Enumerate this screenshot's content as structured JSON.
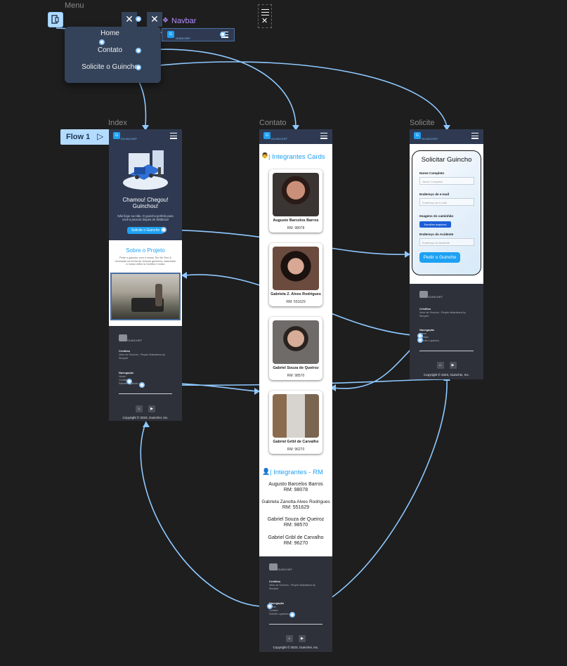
{
  "canvas": {
    "frame_labels": {
      "menu": "Menu",
      "navbar": "Navbar",
      "index": "Index",
      "contato": "Contato",
      "solicite": "Solicite"
    },
    "flow_label": "Flow 1",
    "colors": {
      "background": "#1e1e1e",
      "connector": "#8ec8ff",
      "navbar": "#2f3a52",
      "accent": "#1ea1f2",
      "footer": "#2e3139"
    }
  },
  "navbar": {
    "logo_text": "GUINCHEF",
    "menu_icon": "hamburger-icon"
  },
  "menu": {
    "items": [
      "Home",
      "Contato",
      "Solicite o Guincho"
    ]
  },
  "index": {
    "hero_title": "Chamou!  Chegou! Guinchou!",
    "hero_text": "Não fique na mão. O guincho perfeito para você a poucos cliques de distância!",
    "cta": "Solicite o Guincho",
    "about_title": "Sobre o Projeto",
    "about_text": "Pede o guincho com o nosso Tec Wc Tec! A revolução na forma de chamar guinchos, associado a nossa valha Ia Guinba e nosso"
  },
  "footer": {
    "logo_text": "GUINCHEF",
    "credits_title": "Créditos",
    "credits_text": "Vetor de Guincho - People illustrations by Storyset",
    "nav_title": "Navegação",
    "nav_items": [
      "Home",
      "Contato",
      "Solicite o guincho"
    ],
    "copyright": "Copyright © 2023, Guinchei, Inc."
  },
  "contato": {
    "cards_title": "| Integrantes Cards",
    "cards": [
      {
        "name": "Augusto Barcelos Barros",
        "rm": "RM: 98078"
      },
      {
        "name": "Gabriela Z. Alves Rodrigues",
        "rm": "RM: 551629"
      },
      {
        "name": "Gabriel Souza de Queiroz",
        "rm": "RM: 98570"
      },
      {
        "name": "Gabriel Gribl de Carvalho",
        "rm": "RM: 96270"
      }
    ],
    "rm_title": "| Integrantes - RM",
    "rm_list": [
      {
        "name": "Augusto Barcelos Barros",
        "rm": "RM: 98078"
      },
      {
        "name": "Gabriela Zanotta Alves Rodrigues",
        "rm": "RM: 551629"
      },
      {
        "name": "Gabriel Souza de Queiroz",
        "rm": "RM: 98570"
      },
      {
        "name": "Gabriel Gribl de Carvalho",
        "rm": "RM: 96270"
      }
    ]
  },
  "solicite": {
    "form_title": "Solicitar Guincho",
    "full_name_label": "Nome Completo",
    "full_name_placeholder": "Nome Completo",
    "email_label": "Endereço de e-mail",
    "email_placeholder": "Endereço de e-mail",
    "images_label": "Imagens do caminhão",
    "choose_files": "Escolher arquivos",
    "address_label": "Endereço do Acidente",
    "address_placeholder": "Endereço do Acidente",
    "submit": "Pedir o Guincho"
  }
}
